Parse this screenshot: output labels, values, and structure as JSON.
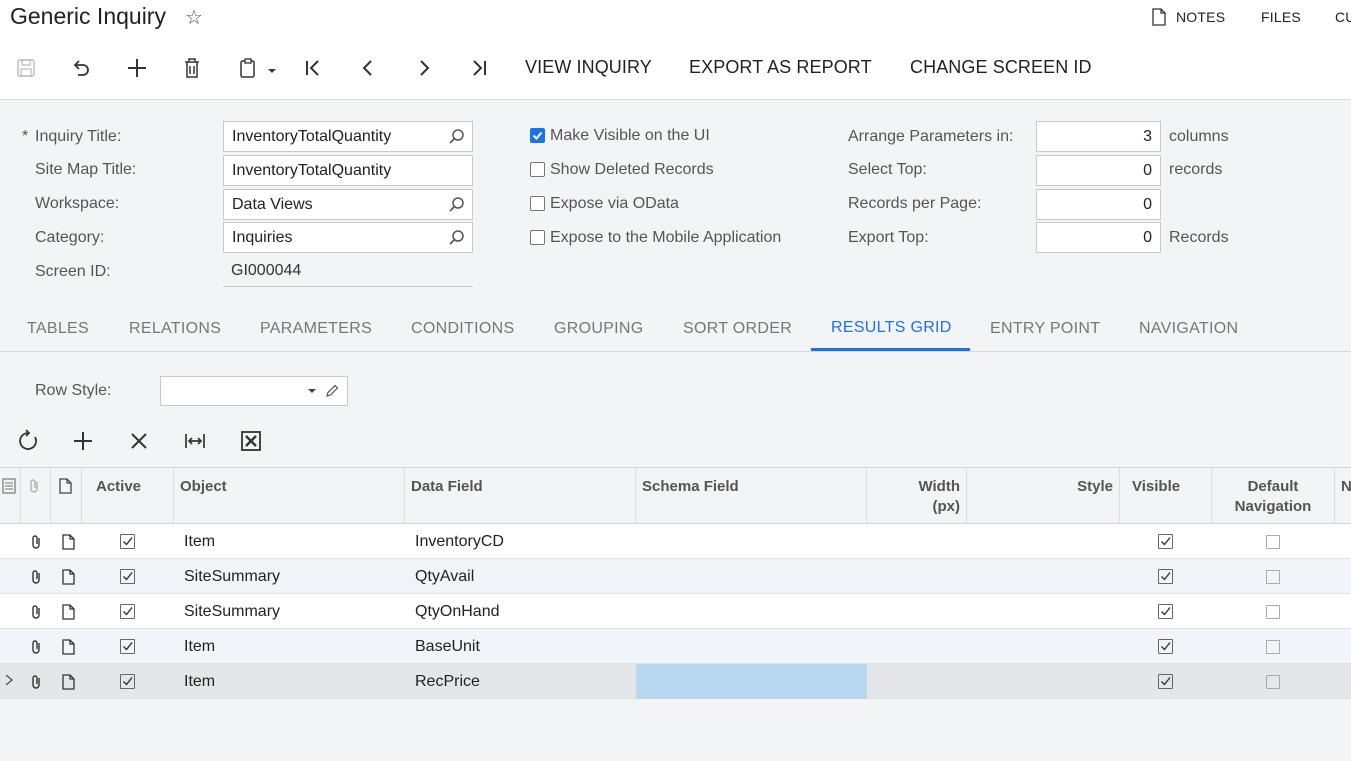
{
  "header": {
    "title": "Generic Inquiry",
    "links": {
      "notes": "NOTES",
      "files": "FILES",
      "customization": "CU"
    }
  },
  "toolbar": {
    "view_inquiry": "VIEW INQUIRY",
    "export_as_report": "EXPORT AS REPORT",
    "change_screen_id": "CHANGE SCREEN ID"
  },
  "form": {
    "required_mark": "*",
    "inquiry_title": {
      "label": "Inquiry Title:",
      "value": "InventoryTotalQuantity"
    },
    "site_map_title": {
      "label": "Site Map Title:",
      "value": "InventoryTotalQuantity"
    },
    "workspace": {
      "label": "Workspace:",
      "value": "Data Views"
    },
    "category": {
      "label": "Category:",
      "value": "Inquiries"
    },
    "screen_id": {
      "label": "Screen ID:",
      "value": "GI000044"
    },
    "checkboxes": {
      "make_visible": {
        "label": "Make Visible on the UI",
        "checked": true
      },
      "show_deleted": {
        "label": "Show Deleted Records",
        "checked": false
      },
      "expose_odata": {
        "label": "Expose via OData",
        "checked": false
      },
      "expose_mobile": {
        "label": "Expose to the Mobile Application",
        "checked": false
      }
    },
    "arrange_params": {
      "label": "Arrange Parameters in:",
      "value": "3",
      "suffix": "columns"
    },
    "select_top": {
      "label": "Select Top:",
      "value": "0",
      "suffix": "records"
    },
    "records_per_page": {
      "label": "Records per Page:",
      "value": "0"
    },
    "export_top": {
      "label": "Export Top:",
      "value": "0",
      "suffix": "Records"
    }
  },
  "tabs": {
    "tables": "TABLES",
    "relations": "RELATIONS",
    "parameters": "PARAMETERS",
    "conditions": "CONDITIONS",
    "grouping": "GROUPING",
    "sort_order": "SORT ORDER",
    "results_grid": "RESULTS GRID",
    "entry_point": "ENTRY POINT",
    "navigation": "NAVIGATION",
    "active": "results_grid"
  },
  "results": {
    "row_style_label": "Row Style:",
    "row_style_value": "",
    "columns": {
      "active": "Active",
      "object": "Object",
      "data_field": "Data Field",
      "schema_field": "Schema Field",
      "width_1": "Width",
      "width_2": "(px)",
      "style": "Style",
      "visible": "Visible",
      "default_nav_1": "Default",
      "default_nav_2": "Navigation",
      "next_col": "N"
    },
    "rows": [
      {
        "active": true,
        "object": "Item",
        "data_field": "InventoryCD",
        "visible": true,
        "default_navigation": false
      },
      {
        "active": true,
        "object": "SiteSummary",
        "data_field": "QtyAvail",
        "visible": true,
        "default_navigation": false
      },
      {
        "active": true,
        "object": "SiteSummary",
        "data_field": "QtyOnHand",
        "visible": true,
        "default_navigation": false
      },
      {
        "active": true,
        "object": "Item",
        "data_field": "BaseUnit",
        "visible": true,
        "default_navigation": false
      },
      {
        "active": true,
        "object": "Item",
        "data_field": "RecPrice",
        "visible": true,
        "default_navigation": false,
        "selected": true
      }
    ]
  },
  "colors": {
    "accent": "#1a73e8",
    "selected_cell": "#b8d8f2",
    "panel_bg": "#f3f4f6"
  }
}
